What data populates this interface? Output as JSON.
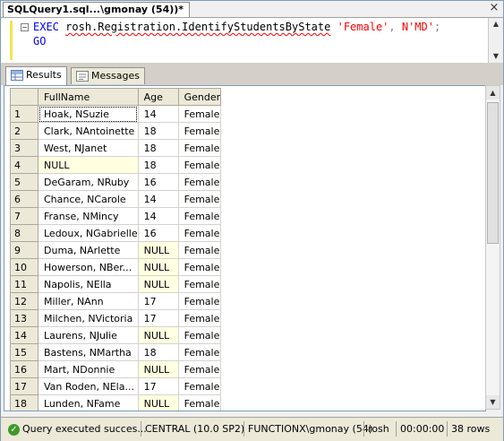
{
  "document_tab": {
    "title": "SQLQuery1.sql...\\gmonay (54))*",
    "close_label": "×"
  },
  "editor": {
    "line1": {
      "exec": "EXEC",
      "procedure": "rosh.Registration.IdentifyStudentsByState",
      "arg1": "'Female'",
      "comma": ",",
      "arg2": "N'MD'",
      "semicolon": ";"
    },
    "line2": {
      "go": "GO"
    }
  },
  "result_tabs": [
    {
      "label": "Results",
      "icon": "grid-icon"
    },
    {
      "label": "Messages",
      "icon": "messages-icon"
    }
  ],
  "grid": {
    "columns": [
      "FullName",
      "Age",
      "Gender"
    ],
    "rows": [
      {
        "n": "1",
        "name": "Hoak, NSuzie",
        "age": "14",
        "gender": "Female"
      },
      {
        "n": "2",
        "name": "Clark, NAntoinette",
        "age": "18",
        "gender": "Female"
      },
      {
        "n": "3",
        "name": "West, NJanet",
        "age": "18",
        "gender": "Female"
      },
      {
        "n": "4",
        "name": "NULL",
        "age": "18",
        "gender": "Female"
      },
      {
        "n": "5",
        "name": "DeGaram, NRuby",
        "age": "16",
        "gender": "Female"
      },
      {
        "n": "6",
        "name": "Chance, NCarole",
        "age": "14",
        "gender": "Female"
      },
      {
        "n": "7",
        "name": "Franse, NMincy",
        "age": "14",
        "gender": "Female"
      },
      {
        "n": "8",
        "name": "Ledoux, NGabrielle",
        "age": "16",
        "gender": "Female"
      },
      {
        "n": "9",
        "name": "Duma, NArlette",
        "age": "NULL",
        "gender": "Female"
      },
      {
        "n": "10",
        "name": "Howerson, NBer...",
        "age": "NULL",
        "gender": "Female"
      },
      {
        "n": "11",
        "name": "Napolis, NElla",
        "age": "NULL",
        "gender": "Female"
      },
      {
        "n": "12",
        "name": "Miller, NAnn",
        "age": "17",
        "gender": "Female"
      },
      {
        "n": "13",
        "name": "Milchen, NVictoria",
        "age": "17",
        "gender": "Female"
      },
      {
        "n": "14",
        "name": "Laurens, NJulie",
        "age": "NULL",
        "gender": "Female"
      },
      {
        "n": "15",
        "name": "Bastens, NMartha",
        "age": "18",
        "gender": "Female"
      },
      {
        "n": "16",
        "name": "Mart, NDonnie",
        "age": "NULL",
        "gender": "Female"
      },
      {
        "n": "17",
        "name": "Van Roden, NEla...",
        "age": "17",
        "gender": "Female"
      },
      {
        "n": "18",
        "name": "Lunden, NFame",
        "age": "NULL",
        "gender": "Female"
      }
    ]
  },
  "status_bar": {
    "message": "Query executed succes...",
    "server": "CENTRAL (10.0 SP2)",
    "login": "FUNCTIONX\\gmonay (54)",
    "database": "rosh",
    "elapsed": "00:00:00",
    "row_count": "38 rows"
  },
  "colors": {
    "null_cell": "#ffffe1",
    "keyword": "#0000ff",
    "string": "#ff0000",
    "ok_icon": "#3c9a2b"
  }
}
